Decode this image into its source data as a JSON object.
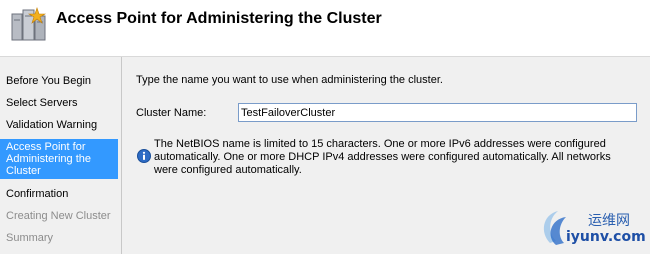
{
  "header": {
    "title": "Access Point for Administering the Cluster",
    "icon": "cluster-wizard-icon"
  },
  "nav": {
    "items": [
      {
        "label": "Before You Begin",
        "state": "normal"
      },
      {
        "label": "Select Servers",
        "state": "normal"
      },
      {
        "label": "Validation Warning",
        "state": "normal"
      },
      {
        "label": "Access Point for Administering the Cluster",
        "state": "selected"
      },
      {
        "label": "Confirmation",
        "state": "normal"
      },
      {
        "label": "Creating New Cluster",
        "state": "disabled"
      },
      {
        "label": "Summary",
        "state": "disabled"
      }
    ],
    "selected_color": "#3399ff"
  },
  "content": {
    "instruction": "Type the name you want to use when administering the cluster.",
    "cluster_name_label": "Cluster Name:",
    "cluster_name_value": "TestFailoverCluster",
    "info_text": "The NetBIOS name is limited to 15 characters.  One or more IPv6 addresses were configured automatically.  One or more DHCP IPv4 addresses were configured automatically.  All networks were configured automatically.",
    "info_icon": "info-icon"
  },
  "watermark": {
    "text_cn": "运维网",
    "url": "iyunv.com"
  }
}
